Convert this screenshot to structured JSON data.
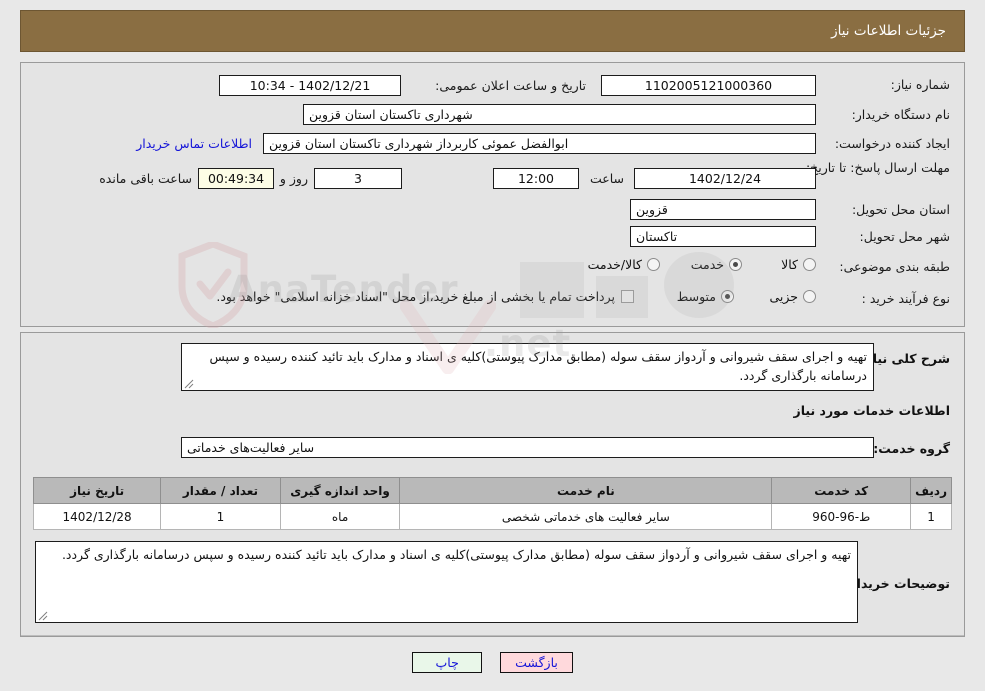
{
  "header": {
    "title": "جزئیات اطلاعات نیاز"
  },
  "form": {
    "need_number_label": "شماره نیاز:",
    "need_number_value": "1102005121000360",
    "announce_label": "تاریخ و ساعت اعلان عمومی:",
    "announce_value": "1402/12/21 - 10:34",
    "buyer_org_label": "نام دستگاه خریدار:",
    "buyer_org_value": "شهرداری تاکستان استان قزوین",
    "requester_label": "ایجاد کننده درخواست:",
    "requester_value": "ابوالفضل عموئی کاربرداز شهرداری تاکستان استان قزوین",
    "contact_link": "اطلاعات تماس خریدار",
    "deadline_label": "مهلت ارسال پاسخ: تا تاریخ:",
    "deadline_date": "1402/12/24",
    "deadline_hour_label": "ساعت",
    "deadline_hour": "12:00",
    "remaining_days": "3",
    "remaining_days_label": "روز و",
    "remaining_time": "00:49:34",
    "remaining_time_label": "ساعت باقی مانده",
    "province_label": "استان محل تحویل:",
    "province_value": "قزوین",
    "city_label": "شهر محل تحویل:",
    "city_value": "تاکستان",
    "category_label": "طبقه بندی موضوعی:",
    "category_options": [
      {
        "label": "کالا",
        "selected": false
      },
      {
        "label": "خدمت",
        "selected": true
      },
      {
        "label": "کالا/خدمت",
        "selected": false
      }
    ],
    "process_label": "نوع فرآیند خرید :",
    "process_options": [
      {
        "label": "جزیی",
        "selected": false
      },
      {
        "label": "متوسط",
        "selected": true
      }
    ],
    "treasury_checkbox_checked": false,
    "treasury_note": "پرداخت تمام یا بخشی از مبلغ خرید،از محل \"اسناد خزانه اسلامی\" خواهد بود."
  },
  "details": {
    "general_desc_label": "شرح کلی نیاز:",
    "general_desc_value": "تهیه و اجرای سقف شیروانی و آردواز سقف سوله (مطابق مدارک پیوستی)کلیه ی اسناد و مدارک باید تائید کننده رسیده و سپس درسامانه بارگذاری گردد.",
    "services_heading": "اطلاعات خدمات مورد نیاز",
    "service_group_label": "گروه خدمت:",
    "service_group_value": "سایر فعالیت‌های خدماتی",
    "buyer_notes_label": "توضیحات خریدار:",
    "buyer_notes_value": "تهیه و اجرای سقف شیروانی و آردواز سقف سوله (مطابق مدارک پیوستی)کلیه ی اسناد و مدارک باید تائید کننده رسیده و سپس درسامانه بارگذاری گردد."
  },
  "table": {
    "columns": [
      "ردیف",
      "کد خدمت",
      "نام خدمت",
      "واحد اندازه گیری",
      "تعداد / مقدار",
      "تاریخ نیاز"
    ],
    "rows": [
      {
        "index": "1",
        "code": "ط-96-960",
        "name": "سایر فعالیت های خدماتی شخصی",
        "unit": "ماه",
        "quantity": "1",
        "need_date": "1402/12/28"
      }
    ]
  },
  "footer": {
    "back_label": "بازگشت",
    "print_label": "چاپ"
  },
  "watermark": {
    "text_left": "AnaTender",
    "text_right": ".net"
  },
  "colors": {
    "header_bg": "#8a6e42",
    "panel_bg": "#e4e4e4",
    "link": "#1414d8",
    "back_btn": "#ffd9dc",
    "print_btn": "#e9f7e9",
    "table_head": "#b9b9b9"
  }
}
